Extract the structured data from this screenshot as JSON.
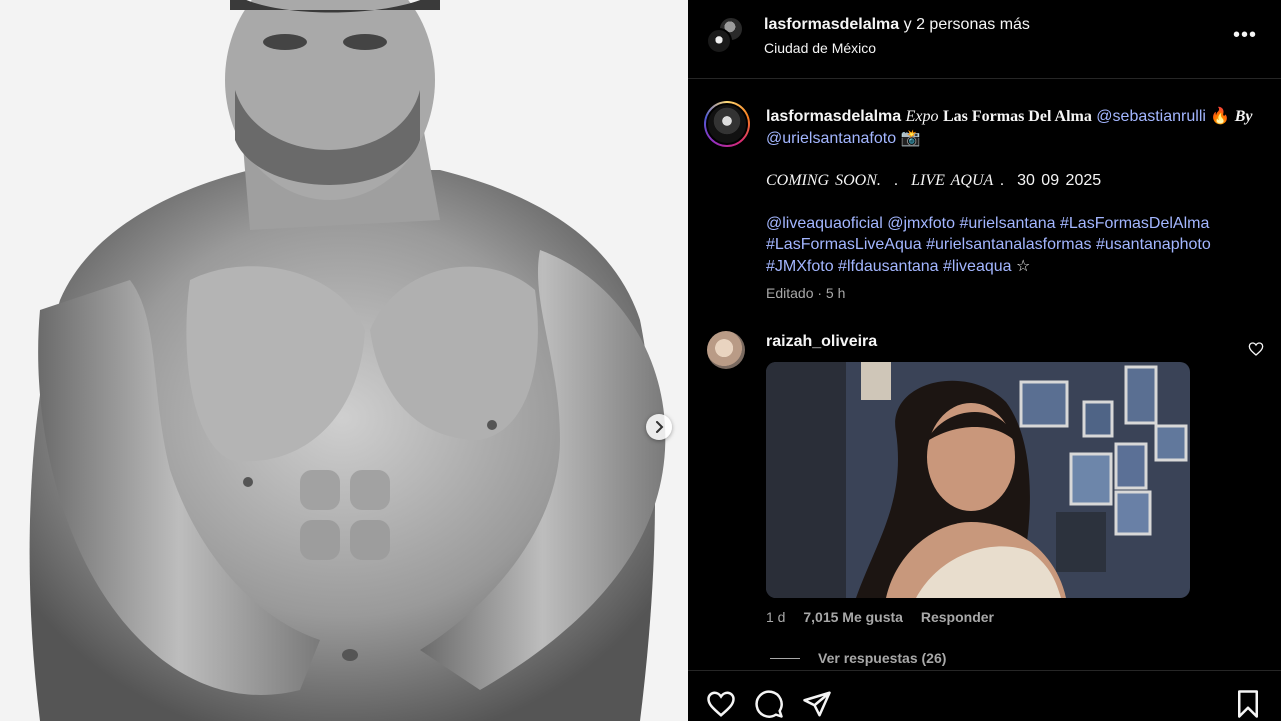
{
  "header": {
    "username": "lasformasdelalma",
    "collab_text": "y 2 personas más",
    "location": "Ciudad de México",
    "more_label": "•••"
  },
  "caption": {
    "username": "lasformasdelalma",
    "expo": "Expo",
    "title": "Las Formas Del Alma",
    "mention1": "@sebastianrulli",
    "emoji1": "🔥",
    "by": "By",
    "mention2": "@urielsantanafoto",
    "emoji2": "📸",
    "line2_a": "COMING SOON.",
    "dot": ".",
    "line2_b": "LIVE AQUA",
    "line2_dot": ".",
    "line2_date": "30 09 2025",
    "tags": [
      "@liveaquaoficial",
      "@jmxfoto",
      "#urielsantana",
      "#LasFormasDelAlma",
      "#LasFormasLiveAqua",
      "#urielsantanalasformas",
      "#usantanaphoto",
      "#JMXfoto",
      "#lfdausantana",
      "#liveaqua"
    ],
    "star": "☆",
    "meta": "Editado · 5 h"
  },
  "comment": {
    "username": "raizah_oliveira",
    "age": "1 d",
    "likes": "7,015 Me gusta",
    "reply": "Responder",
    "view_replies": "Ver respuestas (26)"
  },
  "colors": {
    "link": "#a3b6ff",
    "muted": "#a8a8a8",
    "border": "#262626"
  },
  "icons": {
    "next": "chevron-right-icon",
    "like": "heart-icon",
    "comment": "comment-icon",
    "share": "send-icon",
    "save": "bookmark-icon"
  }
}
